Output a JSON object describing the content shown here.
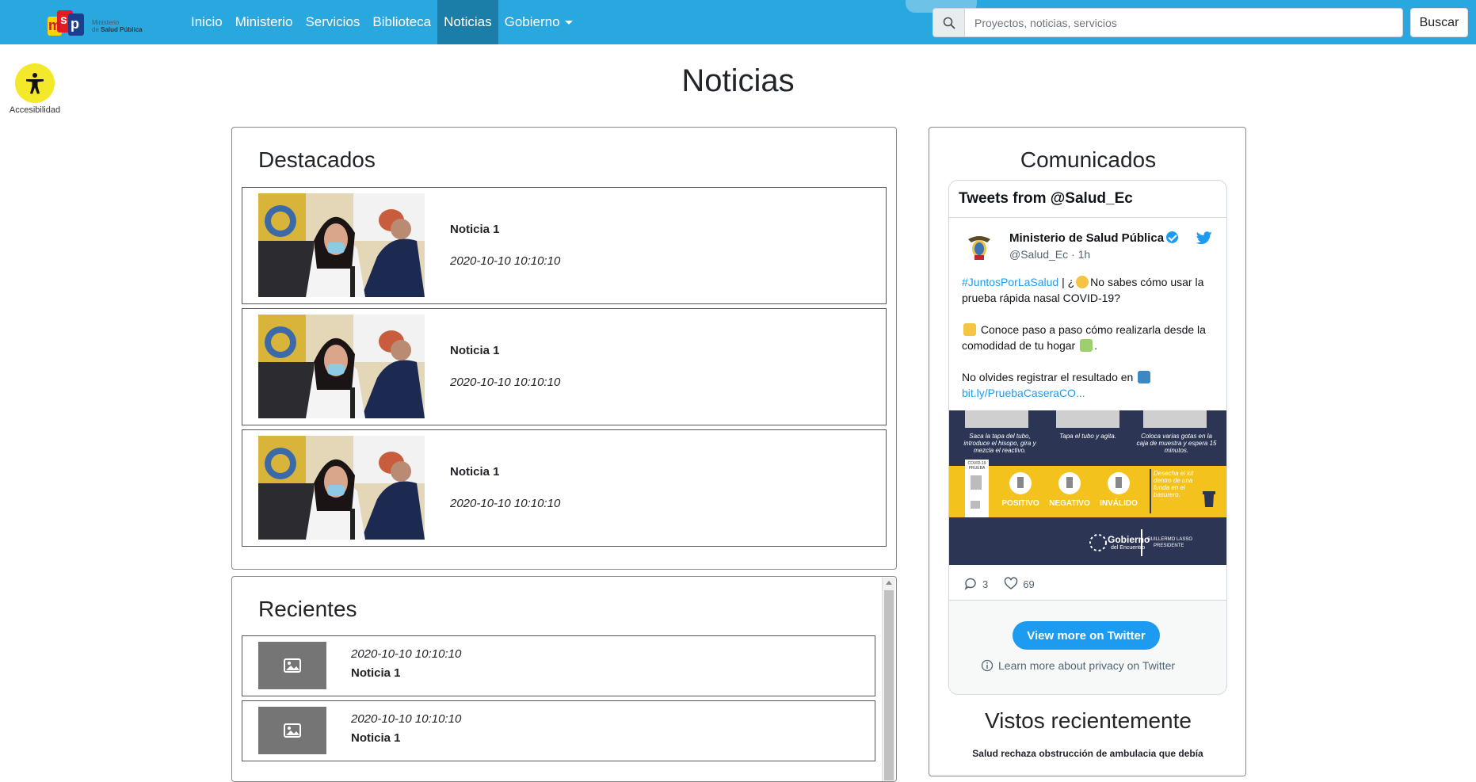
{
  "brand": {
    "logo_letters": [
      "m",
      "s",
      "p"
    ],
    "line1": "Ministerio",
    "line2_prefix": "de",
    "line2": "Salud Pública"
  },
  "nav": {
    "items": [
      {
        "label": "Inicio"
      },
      {
        "label": "Ministerio"
      },
      {
        "label": "Servicios"
      },
      {
        "label": "Biblioteca"
      },
      {
        "label": "Noticias",
        "active": true
      },
      {
        "label": "Gobierno",
        "dropdown": true
      }
    ]
  },
  "search": {
    "placeholder": "Proyectos, noticias, servicios",
    "value": "",
    "button_label": "Buscar"
  },
  "accessibility": {
    "label": "Accesibilidad",
    "icon": "accessibility-icon"
  },
  "page": {
    "title": "Noticias"
  },
  "destacados": {
    "heading": "Destacados",
    "items": [
      {
        "title": "Noticia 1",
        "date": "2020-10-10 10:10:10"
      },
      {
        "title": "Noticia 1",
        "date": "2020-10-10 10:10:10"
      },
      {
        "title": "Noticia 1",
        "date": "2020-10-10 10:10:10"
      }
    ]
  },
  "recientes": {
    "heading": "Recientes",
    "items": [
      {
        "title": "Noticia 1",
        "date": "2020-10-10 10:10:10"
      },
      {
        "title": "Noticia 1",
        "date": "2020-10-10 10:10:10"
      }
    ]
  },
  "comunicados": {
    "heading": "Comunicados",
    "twitter": {
      "header": "Tweets from @Salud_Ec",
      "author_name": "Ministerio de Salud Pública",
      "handle_time": "@Salud_Ec · 1h",
      "hashtag": "#JuntosPorLaSalud",
      "line1": " | ¿",
      "line1b": "No sabes cómo usar la prueba rápida nasal COVID-19?",
      "para2": " Conoce paso a paso cómo realizarla desde la comodidad de tu hogar ",
      "para3": "No olvides registrar el resultado en ",
      "link": "bit.ly/PruebaCaseraCO...",
      "media": {
        "step1": "Saca la tapa del tubo, introduce el hisopo, gira y mezcla el reactivo.",
        "step2": "Tapa el tubo y agita.",
        "step3": "Coloca varias gotas en la caja de muestra y espera 15 minutos.",
        "kit_label": "COVID-19 PRUEBA",
        "result1": "POSITIVO",
        "result2": "NEGATIVO",
        "result3": "INVÁLIDO",
        "dispose": "Desecha el kit dentro de una funda en el basurero.",
        "gov1": "Gobierno",
        "gov2": "del Encuentro",
        "president1": "GUILLERMO LASSO",
        "president2": "PRESIDENTE"
      },
      "replies": "3",
      "likes": "69",
      "view_more": "View more on Twitter",
      "privacy": "Learn more about privacy on Twitter"
    }
  },
  "vistos": {
    "heading": "Vistos recientemente",
    "item": "Salud rechaza obstrucción de ambulacia que debía"
  },
  "colors": {
    "navbar": "#29a8e0",
    "nav_active": "#1a7ea8",
    "accessibility": "#f4e82a",
    "twitter_blue": "#1d9bf0"
  }
}
